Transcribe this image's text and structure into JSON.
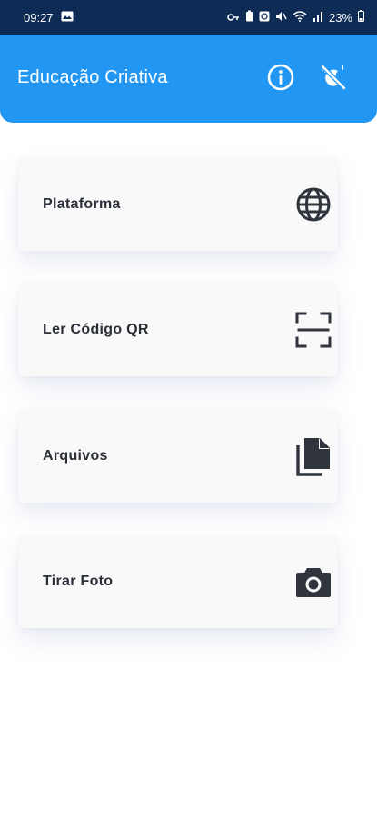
{
  "status_bar": {
    "time": "09:27",
    "battery": "23%"
  },
  "app_bar": {
    "title": "Educação Criativa",
    "icons": [
      "info-icon",
      "theme-toggle-icon"
    ]
  },
  "menu": {
    "items": [
      {
        "label": "Plataforma",
        "icon": "globe-icon"
      },
      {
        "label": "Ler Código QR",
        "icon": "qr-scan-icon"
      },
      {
        "label": "Arquivos",
        "icon": "files-icon"
      },
      {
        "label": "Tirar Foto",
        "icon": "camera-icon"
      }
    ]
  },
  "colors": {
    "app_bar": "#2196f3",
    "status_bar": "#0d2b54",
    "card_background": "#f9f9fa",
    "icon": "#2f343d"
  }
}
